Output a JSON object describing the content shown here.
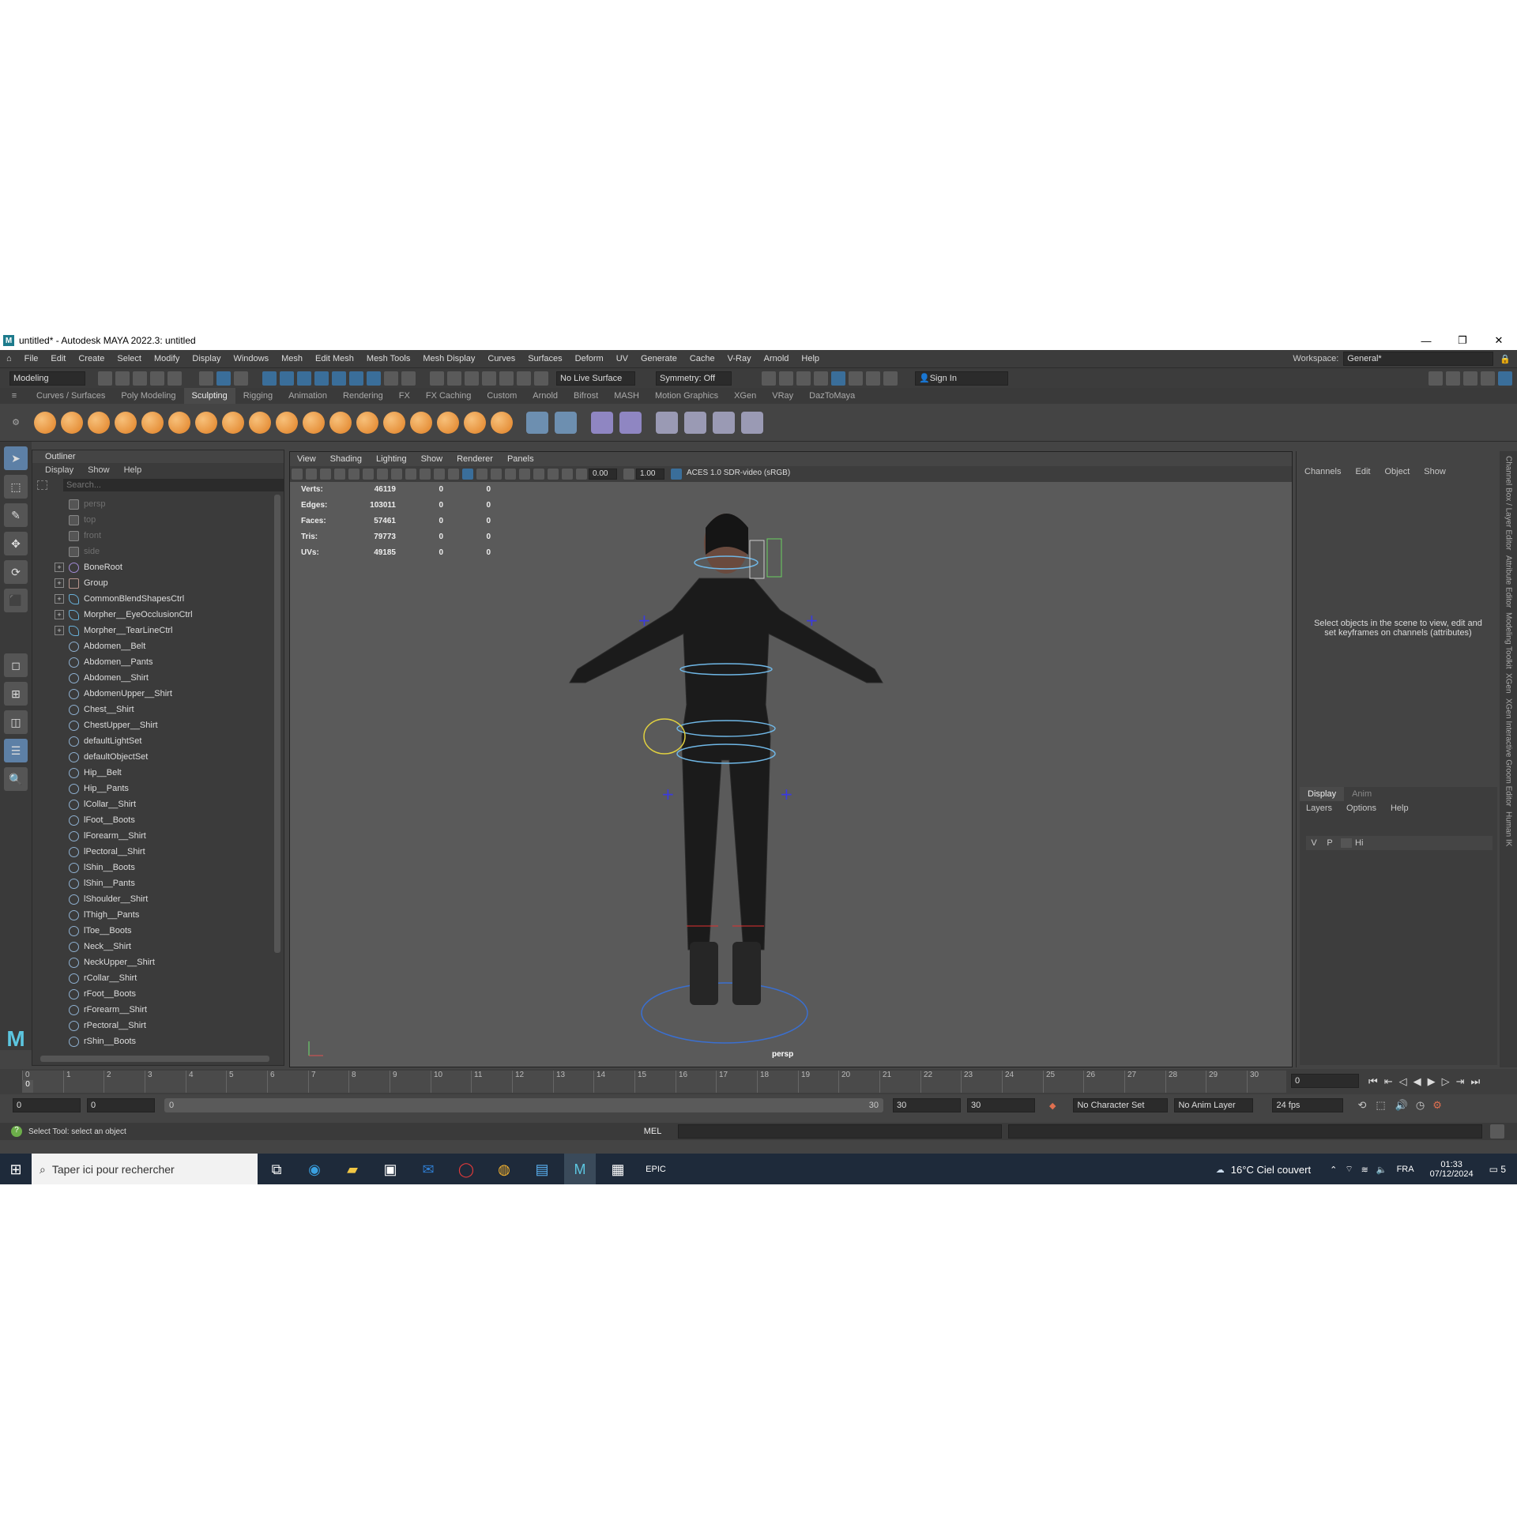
{
  "title_bar": {
    "title": "untitled* - Autodesk MAYA 2022.3: untitled",
    "logo": "M"
  },
  "menu_bar": [
    "File",
    "Edit",
    "Create",
    "Select",
    "Modify",
    "Display",
    "Windows",
    "Mesh",
    "Edit Mesh",
    "Mesh Tools",
    "Mesh Display",
    "Curves",
    "Surfaces",
    "Deform",
    "UV",
    "Generate",
    "Cache",
    "V-Ray",
    "Arnold",
    "Help"
  ],
  "workspace": {
    "label": "Workspace:",
    "value": "General*"
  },
  "status_line": {
    "mode": "Modeling",
    "live_surface": "No Live Surface",
    "symmetry": "Symmetry: Off",
    "sign_in": "Sign In"
  },
  "shelf_tabs": [
    "Curves / Surfaces",
    "Poly Modeling",
    "Sculpting",
    "Rigging",
    "Animation",
    "Rendering",
    "FX",
    "FX Caching",
    "Custom",
    "Arnold",
    "Bifrost",
    "MASH",
    "Motion Graphics",
    "XGen",
    "VRay",
    "DazToMaya"
  ],
  "active_shelf_tab": "Sculpting",
  "outliner": {
    "title": "Outliner",
    "menu": [
      "Display",
      "Show",
      "Help"
    ],
    "search_placeholder": "Search...",
    "items": [
      {
        "label": "persp",
        "icon": "camera-icon",
        "dim": true,
        "expandable": false
      },
      {
        "label": "top",
        "icon": "camera-icon",
        "dim": true,
        "expandable": false
      },
      {
        "label": "front",
        "icon": "camera-icon",
        "dim": true,
        "expandable": false
      },
      {
        "label": "side",
        "icon": "camera-icon",
        "dim": true,
        "expandable": false
      },
      {
        "label": "BoneRoot",
        "icon": "joint-icon",
        "dim": false,
        "expandable": true
      },
      {
        "label": "Group",
        "icon": "group-icon",
        "dim": false,
        "expandable": true
      },
      {
        "label": "CommonBlendShapesCtrl",
        "icon": "curve-icon",
        "dim": false,
        "expandable": true
      },
      {
        "label": "Morpher__EyeOcclusionCtrl",
        "icon": "curve-icon",
        "dim": false,
        "expandable": true
      },
      {
        "label": "Morpher__TearLineCtrl",
        "icon": "curve-icon",
        "dim": false,
        "expandable": true
      },
      {
        "label": "Abdomen__Belt",
        "icon": "set-icon",
        "dim": false,
        "expandable": false
      },
      {
        "label": "Abdomen__Pants",
        "icon": "set-icon",
        "dim": false,
        "expandable": false
      },
      {
        "label": "Abdomen__Shirt",
        "icon": "set-icon",
        "dim": false,
        "expandable": false
      },
      {
        "label": "AbdomenUpper__Shirt",
        "icon": "set-icon",
        "dim": false,
        "expandable": false
      },
      {
        "label": "Chest__Shirt",
        "icon": "set-icon",
        "dim": false,
        "expandable": false
      },
      {
        "label": "ChestUpper__Shirt",
        "icon": "set-icon",
        "dim": false,
        "expandable": false
      },
      {
        "label": "defaultLightSet",
        "icon": "set-icon",
        "dim": false,
        "expandable": false
      },
      {
        "label": "defaultObjectSet",
        "icon": "set-icon",
        "dim": false,
        "expandable": false
      },
      {
        "label": "Hip__Belt",
        "icon": "set-icon",
        "dim": false,
        "expandable": false
      },
      {
        "label": "Hip__Pants",
        "icon": "set-icon",
        "dim": false,
        "expandable": false
      },
      {
        "label": "lCollar__Shirt",
        "icon": "set-icon",
        "dim": false,
        "expandable": false
      },
      {
        "label": "lFoot__Boots",
        "icon": "set-icon",
        "dim": false,
        "expandable": false
      },
      {
        "label": "lForearm__Shirt",
        "icon": "set-icon",
        "dim": false,
        "expandable": false
      },
      {
        "label": "lPectoral__Shirt",
        "icon": "set-icon",
        "dim": false,
        "expandable": false
      },
      {
        "label": "lShin__Boots",
        "icon": "set-icon",
        "dim": false,
        "expandable": false
      },
      {
        "label": "lShin__Pants",
        "icon": "set-icon",
        "dim": false,
        "expandable": false
      },
      {
        "label": "lShoulder__Shirt",
        "icon": "set-icon",
        "dim": false,
        "expandable": false
      },
      {
        "label": "lThigh__Pants",
        "icon": "set-icon",
        "dim": false,
        "expandable": false
      },
      {
        "label": "lToe__Boots",
        "icon": "set-icon",
        "dim": false,
        "expandable": false
      },
      {
        "label": "Neck__Shirt",
        "icon": "set-icon",
        "dim": false,
        "expandable": false
      },
      {
        "label": "NeckUpper__Shirt",
        "icon": "set-icon",
        "dim": false,
        "expandable": false
      },
      {
        "label": "rCollar__Shirt",
        "icon": "set-icon",
        "dim": false,
        "expandable": false
      },
      {
        "label": "rFoot__Boots",
        "icon": "set-icon",
        "dim": false,
        "expandable": false
      },
      {
        "label": "rForearm__Shirt",
        "icon": "set-icon",
        "dim": false,
        "expandable": false
      },
      {
        "label": "rPectoral__Shirt",
        "icon": "set-icon",
        "dim": false,
        "expandable": false
      },
      {
        "label": "rShin__Boots",
        "icon": "set-icon",
        "dim": false,
        "expandable": false
      }
    ]
  },
  "viewport": {
    "menu": [
      "View",
      "Shading",
      "Lighting",
      "Show",
      "Renderer",
      "Panels"
    ],
    "exposure": "0.00",
    "gamma": "1.00",
    "color_space": "ACES 1.0 SDR-video (sRGB)",
    "camera_label": "persp",
    "hud": [
      {
        "label": "Verts:",
        "v1": "46119",
        "v2": "0",
        "v3": "0"
      },
      {
        "label": "Edges:",
        "v1": "103011",
        "v2": "0",
        "v3": "0"
      },
      {
        "label": "Faces:",
        "v1": "57461",
        "v2": "0",
        "v3": "0"
      },
      {
        "label": "Tris:",
        "v1": "79773",
        "v2": "0",
        "v3": "0"
      },
      {
        "label": "UVs:",
        "v1": "49185",
        "v2": "0",
        "v3": "0"
      }
    ]
  },
  "channel_box": {
    "menu": [
      "Channels",
      "Edit",
      "Object",
      "Show"
    ],
    "hint": "Select objects in the scene to view, edit and set keyframes on channels (attributes)",
    "layer_tabs": [
      "Display",
      "Anim"
    ],
    "layer_menu": [
      "Layers",
      "Options",
      "Help"
    ],
    "layer_row": {
      "v": "V",
      "p": "P",
      "name": "Hi"
    }
  },
  "side_tabs": [
    "Channel Box / Layer Editor",
    "Attribute Editor",
    "Modeling Toolkit",
    "XGen",
    "XGen Interactive Groom Editor",
    "Human IK"
  ],
  "timeline": {
    "ticks": [
      "0",
      "1",
      "2",
      "3",
      "4",
      "5",
      "6",
      "7",
      "8",
      "9",
      "10",
      "11",
      "12",
      "13",
      "14",
      "15",
      "16",
      "17",
      "18",
      "19",
      "20",
      "21",
      "22",
      "23",
      "24",
      "25",
      "26",
      "27",
      "28",
      "29",
      "30"
    ],
    "current_frame_field": "0",
    "current_frame_marker": "0"
  },
  "range": {
    "start": "0",
    "anim_start": "0",
    "range_start": "0",
    "range_end": "30",
    "end": "30",
    "anim_end": "30",
    "character_set": "No Character Set",
    "anim_layer": "No Anim Layer",
    "fps": "24 fps"
  },
  "command_line": {
    "help_text": "Select Tool: select an object",
    "lang": "MEL"
  },
  "taskbar": {
    "search_placeholder": "Taper ici pour rechercher",
    "weather": "16°C  Ciel couvert",
    "lang": "FRA",
    "time": "01:33",
    "date": "07/12/2024",
    "notifications": "5"
  },
  "colors": {
    "accent": "#5d80a6",
    "panel": "#444444",
    "dark": "#2b2b2b",
    "viewport": "#5a5a5a",
    "shelf_icon": "#e48a2e"
  }
}
